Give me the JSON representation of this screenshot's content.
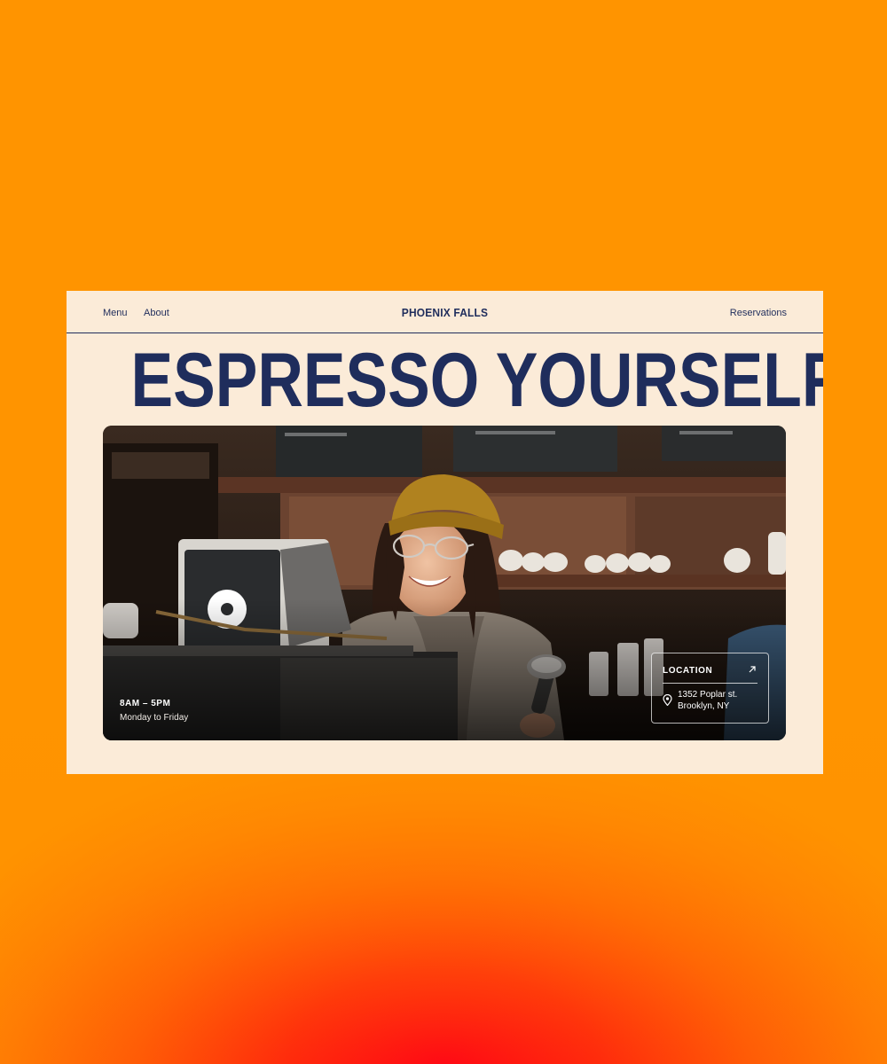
{
  "nav": {
    "menu_label": "Menu",
    "about_label": "About",
    "brand": "PHOENIX FALLS",
    "reservations_label": "Reservations"
  },
  "hero": {
    "headline": "ESPRESSO YOURSELF",
    "hours": {
      "time": "8AM – 5PM",
      "days": "Monday to Friday"
    },
    "location": {
      "title": "LOCATION",
      "address_line1": "1352 Poplar st.",
      "address_line2": "Brooklyn, NY"
    }
  },
  "colors": {
    "navy": "#1f2d5c",
    "cream": "#fbebd8",
    "orange": "#ff9400",
    "red": "#ff0a14"
  },
  "icons": {
    "location_arrow": "arrow-up-right-icon",
    "location_pin": "map-pin-icon"
  }
}
